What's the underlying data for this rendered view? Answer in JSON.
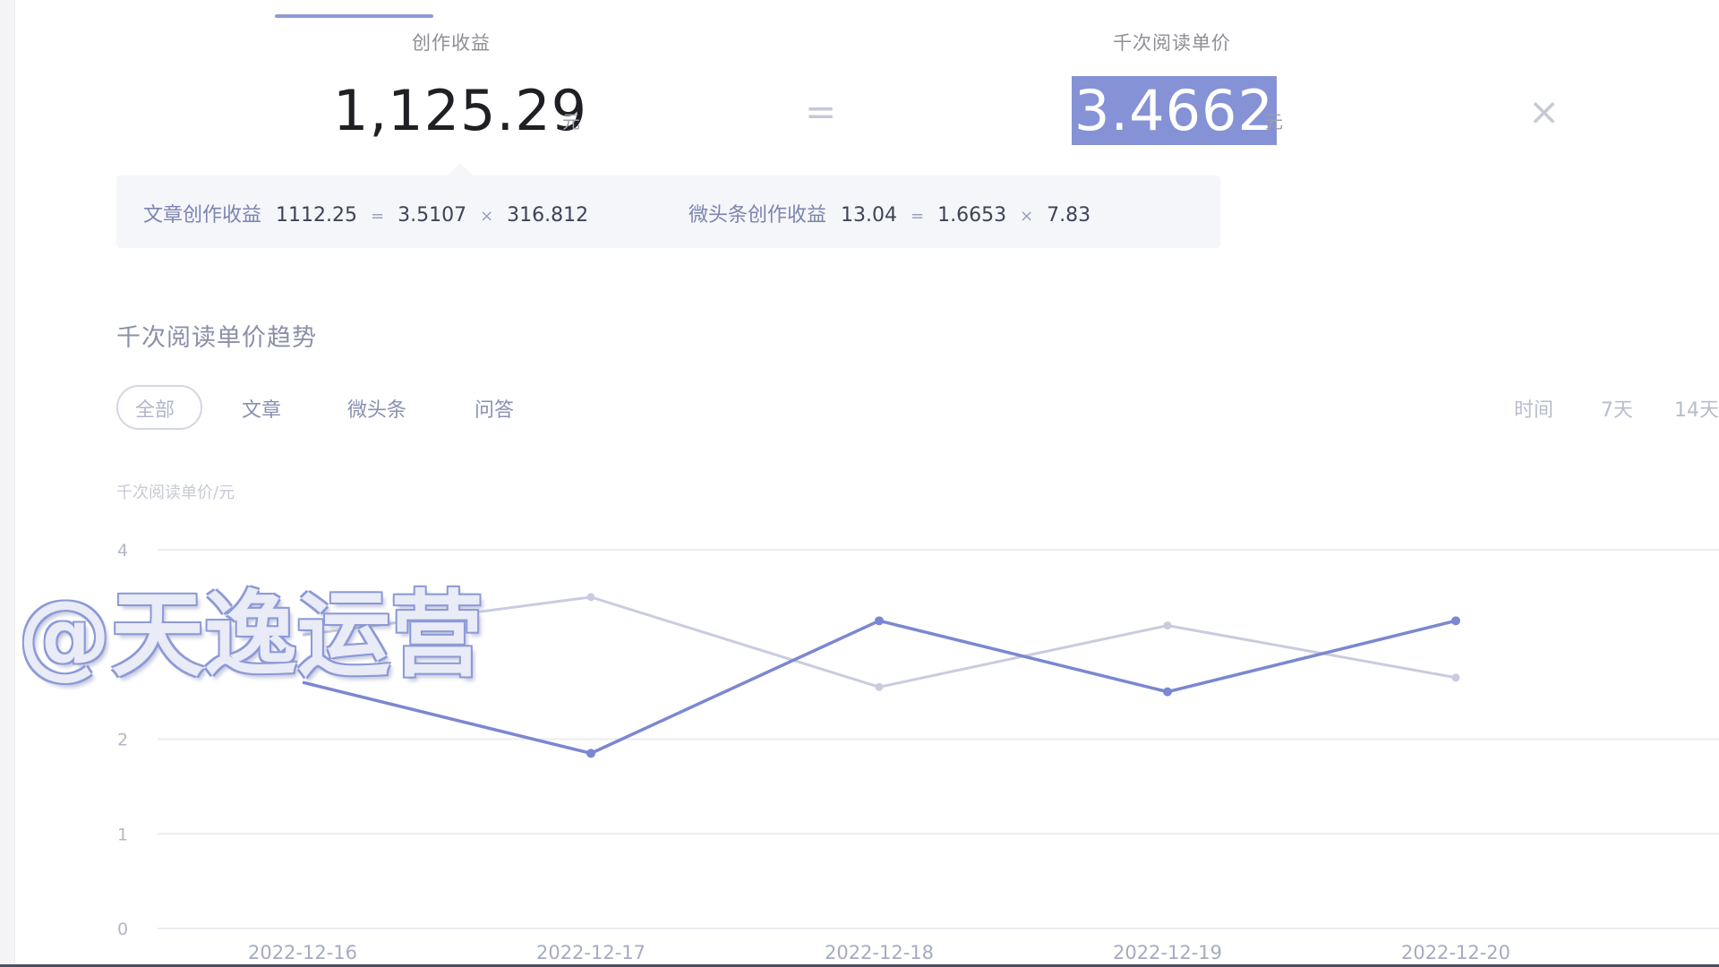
{
  "metrics": {
    "earnings": {
      "label": "创作收益",
      "value": "1,125.29",
      "unit": "元"
    },
    "equals_sign": "=",
    "rpm": {
      "label": "千次阅读单价",
      "value": "3.4662",
      "unit": "元"
    },
    "times_sign": "×"
  },
  "formulas": [
    {
      "label": "文章创作收益",
      "total": "1112.25",
      "eq": "=",
      "price": "3.5107",
      "mul": "×",
      "reads": "316.812"
    },
    {
      "label": "微头条创作收益",
      "total": "13.04",
      "eq": "=",
      "price": "1.6653",
      "mul": "×",
      "reads": "7.83"
    }
  ],
  "trend": {
    "title": "千次阅读单价趋势",
    "filters": [
      "全部",
      "文章",
      "微头条",
      "问答"
    ],
    "active_filter": "全部",
    "range_label": "时间",
    "ranges": [
      "7天",
      "14天"
    ]
  },
  "watermark": "@天逸运营",
  "colors": {
    "accent": "#8592d6",
    "series_primary": "#7b87d0",
    "series_secondary": "#c9ccdf",
    "grid": "#ececf1"
  },
  "chart_data": {
    "type": "line",
    "ylabel": "千次阅读单价/元",
    "ylim": [
      0,
      4
    ],
    "yticks": [
      0,
      1,
      2,
      4
    ],
    "categories": [
      "2022-12-16",
      "2022-12-17",
      "2022-12-18",
      "2022-12-19",
      "2022-12-20"
    ],
    "series": [
      {
        "values": [
          2.6,
          1.85,
          3.25,
          2.5,
          3.25
        ]
      },
      {
        "values": [
          3.1,
          3.5,
          2.55,
          3.2,
          2.65
        ]
      }
    ],
    "grid": true
  }
}
